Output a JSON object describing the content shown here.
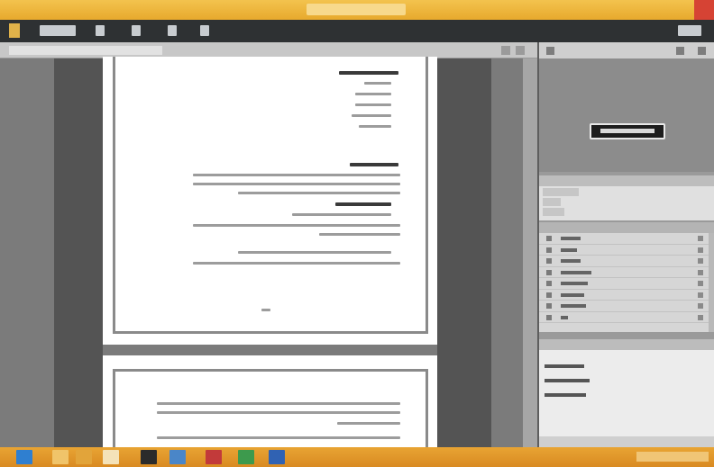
{
  "window": {
    "title": "",
    "controls": [
      "minimize",
      "maximize",
      "close"
    ]
  },
  "toolbar": {
    "items": [
      "app-logo-icon",
      "undo-icon",
      "redo-icon",
      "zoom-icon",
      "arrow-icon"
    ],
    "label": ""
  },
  "document": {
    "pages": 2
  },
  "right_panel": {
    "sections": [
      "preview",
      "properties",
      "layers",
      "pages"
    ],
    "layer_count": 8
  },
  "taskbar": {
    "icons": [
      "start-icon",
      "explorer-icon",
      "folder-icon",
      "browser-icon",
      "app-icon",
      "media-icon",
      "acrobat-icon",
      "excel-icon",
      "word-icon"
    ],
    "colors": {
      "titlebar": "#f3c34e",
      "toolbar": "#2e3133",
      "taskbar": "#e8a433",
      "close": "#d64334"
    }
  }
}
